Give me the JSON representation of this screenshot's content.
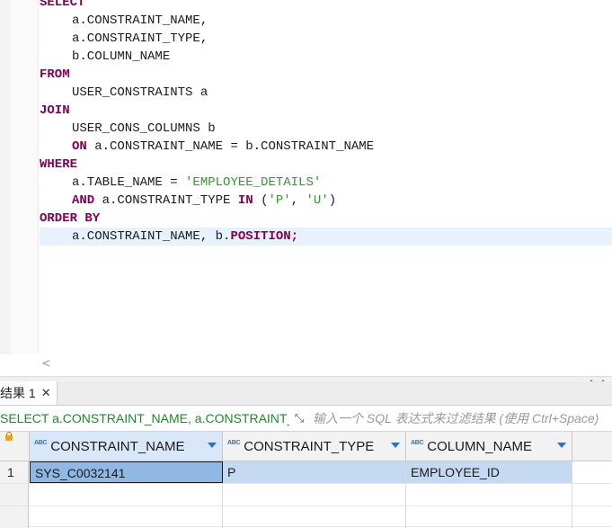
{
  "editor": {
    "lines": [
      [
        {
          "t": "SELECT",
          "k": "kw"
        }
      ],
      [
        {
          "t": "    ",
          "k": "ind"
        },
        {
          "t": "a.CONSTRAINT_NAME,",
          "k": ""
        }
      ],
      [
        {
          "t": "    ",
          "k": "ind"
        },
        {
          "t": "a.CONSTRAINT_TYPE,",
          "k": ""
        }
      ],
      [
        {
          "t": "    ",
          "k": "ind"
        },
        {
          "t": "b.COLUMN_NAME",
          "k": ""
        }
      ],
      [
        {
          "t": "FROM",
          "k": "kw"
        }
      ],
      [
        {
          "t": "    ",
          "k": "ind"
        },
        {
          "t": "USER_CONSTRAINTS a",
          "k": ""
        }
      ],
      [
        {
          "t": "JOIN",
          "k": "kw"
        }
      ],
      [
        {
          "t": "    ",
          "k": "ind"
        },
        {
          "t": "USER_CONS_COLUMNS b",
          "k": ""
        }
      ],
      [
        {
          "t": "    ",
          "k": "ind"
        },
        {
          "t": "ON",
          "k": "kw"
        },
        {
          "t": " a.CONSTRAINT_NAME = b.CONSTRAINT_NAME",
          "k": ""
        }
      ],
      [
        {
          "t": "WHERE",
          "k": "kw"
        }
      ],
      [
        {
          "t": "    ",
          "k": "ind"
        },
        {
          "t": "a.TABLE_NAME = ",
          "k": ""
        },
        {
          "t": "'EMPLOYEE_DETAILS'",
          "k": "str"
        }
      ],
      [
        {
          "t": "    ",
          "k": "ind"
        },
        {
          "t": "AND",
          "k": "kw"
        },
        {
          "t": " a.CONSTRAINT_TYPE ",
          "k": ""
        },
        {
          "t": "IN",
          "k": "kw"
        },
        {
          "t": " (",
          "k": ""
        },
        {
          "t": "'P'",
          "k": "str"
        },
        {
          "t": ", ",
          "k": ""
        },
        {
          "t": "'U'",
          "k": "str"
        },
        {
          "t": ")",
          "k": ""
        }
      ],
      [
        {
          "t": "ORDER BY",
          "k": "kw"
        }
      ],
      [
        {
          "t": "    ",
          "k": "ind"
        },
        {
          "t": "a.CONSTRAINT_NAME, b.",
          "k": ""
        },
        {
          "t": "POSITION",
          "k": "kw"
        },
        {
          "t": ";",
          "k": "kw"
        }
      ]
    ]
  },
  "results": {
    "tab_label": "结果 1",
    "close_glyph": "✕",
    "query_text": "SELECT a.CONSTRAINT_NAME, a.CONSTRAINT_TYPE, b.COLUMN_NAME FROM USER_CONSTRAINTS a",
    "filter_placeholder": "输入一个 SQL 表达式来过滤结果 (使用 Ctrl+Space)",
    "abc_label": "ABC",
    "columns": [
      "CONSTRAINT_NAME",
      "CONSTRAINT_TYPE",
      "COLUMN_NAME"
    ],
    "rows": [
      {
        "num": "1",
        "cells": [
          "SYS_C0032141",
          "P",
          "EMPLOYEE_ID"
        ]
      }
    ]
  },
  "colors": {
    "keyword": "#7f0055",
    "string": "#2a9d2a",
    "query_text": "#1d8a2a",
    "selection": "#c5daf0"
  }
}
